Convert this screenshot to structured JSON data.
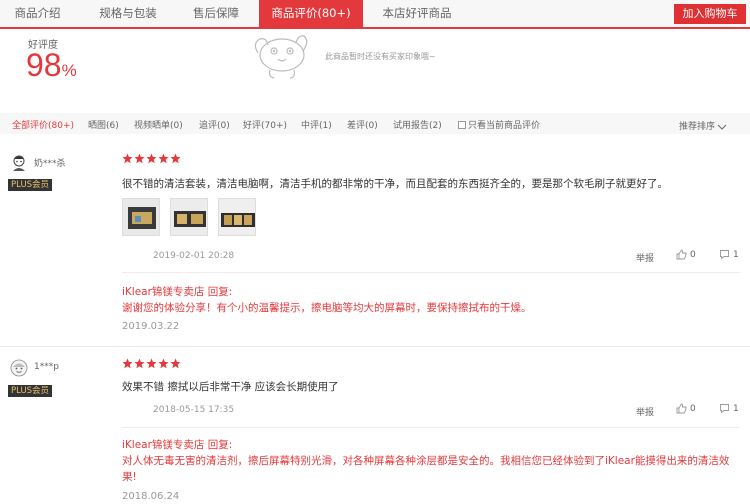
{
  "tabs": [
    {
      "label": "商品介绍"
    },
    {
      "label": "规格与包装"
    },
    {
      "label": "售后保障"
    },
    {
      "label": "商品评价(80+)"
    },
    {
      "label": "本店好评商品"
    }
  ],
  "cart_button": "加入购物车",
  "rating": {
    "label": "好评度",
    "value": "98",
    "unit": "%"
  },
  "empty_tip": "此商品暂时还没有买家印象哦~",
  "filters": [
    {
      "label": "全部评价(80+)"
    },
    {
      "label": "晒图(6)"
    },
    {
      "label": "视频晒单(0)"
    },
    {
      "label": "追评(0)"
    },
    {
      "label": "好评(70+)"
    },
    {
      "label": "中评(1)"
    },
    {
      "label": "差评(0)"
    },
    {
      "label": "试用报告(2)"
    },
    {
      "label": "只看当前商品评价"
    }
  ],
  "sort_label": "推荐排序",
  "colors": {
    "accent": "#e4393c",
    "star": "#e4393c",
    "plus_badge_bg": "#333333",
    "plus_badge_text": "#e8c170"
  },
  "reviews": [
    {
      "user": "奶***杀",
      "badge": "PLUS会员",
      "rating": 5,
      "content": "很不错的清洁套装，清洁电脑啊，清洁手机的都非常的干净，而且配套的东西挺齐全的，要是那个软毛刷子就更好了。",
      "date": "2019-02-01 20:28",
      "report": "举报",
      "likes": "0",
      "comments": "1",
      "reply_from": "iKlear锦镁专卖店 回复:",
      "reply": "谢谢您的体验分享！有个小的温馨提示，擦电脑等均大的屏幕时，要保持擦拭布的干燥。",
      "reply_date": "2019.03.22"
    },
    {
      "user": "1***p",
      "badge": "PLUS会员",
      "rating": 5,
      "content": "效果不错 擦拭以后非常干净 应该会长期使用了",
      "date": "2018-05-15 17:35",
      "report": "举报",
      "likes": "0",
      "comments": "1",
      "reply_from": "iKlear锦镁专卖店 回复:",
      "reply": "对人体无毒无害的清洁剂，擦后屏幕特别光滑，对各种屏幕各种涂层都是安全的。我相信您已经体验到了iKlear能摸得出来的清洁效果!",
      "reply_date": "2018.06.24"
    }
  ]
}
